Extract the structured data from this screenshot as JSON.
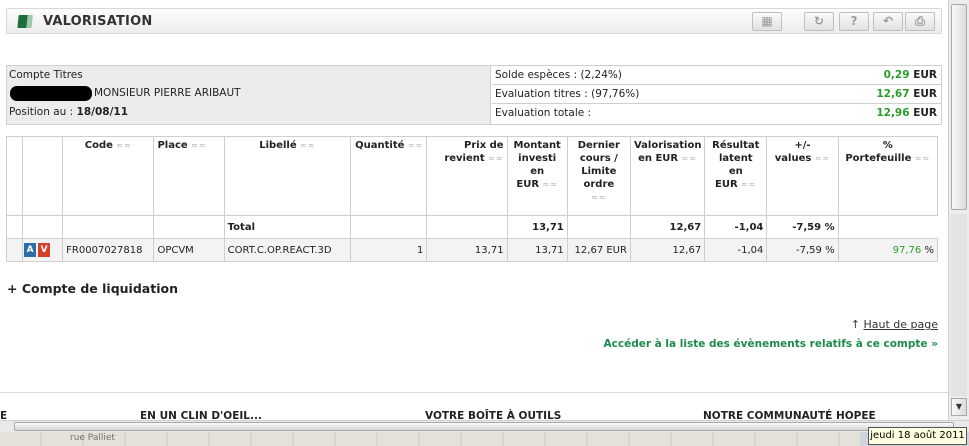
{
  "title": "VALORISATION",
  "toolbar": {
    "icons": [
      "export-icon",
      "refresh-icon",
      "help-icon",
      "back-icon",
      "print-icon"
    ],
    "glyphs": [
      "▦",
      "↻",
      "?",
      "↶",
      "⎙"
    ]
  },
  "account": {
    "label": "Compte Titres",
    "holder": "MONSIEUR PIERRE ARIBAUT",
    "position_label": "Position au :",
    "position_date": "18/08/11",
    "rows": [
      {
        "label": "Solde espèces : (2,24%)",
        "value": "0,29",
        "currency": "EUR"
      },
      {
        "label": "Evaluation titres :  (97,76%)",
        "value": "12,67",
        "currency": "EUR"
      },
      {
        "label": "Evaluation totale :",
        "value": "12,96",
        "currency": "EUR"
      }
    ]
  },
  "table": {
    "headers": {
      "code": "Code",
      "place": "Place",
      "libelle": "Libellé",
      "quantite": "Quantité",
      "prix1": "Prix de",
      "prix2": "revient",
      "mont1": "Montant",
      "mont2": "investi",
      "mont3": "en",
      "mont4": "EUR",
      "dern1": "Dernier",
      "dern2": "cours /",
      "dern3": "Limite",
      "dern4": "ordre",
      "valo1": "Valorisation",
      "valo2": "en EUR",
      "res1": "Résultat",
      "res2": "latent",
      "res3": "en",
      "res4": "EUR",
      "pm1": "+/-",
      "pm2": "values",
      "pct1": "%",
      "pct2": "Portefeuille"
    },
    "sort_arrows": "≈≈",
    "total": {
      "label": "Total",
      "montant": "13,71",
      "valorisation": "12,67",
      "resultat": "-1,04",
      "plusvalue": "-7,59 %"
    },
    "row": {
      "badge_a": "A",
      "badge_v": "V",
      "code": "FR0007027818",
      "place": "OPCVM",
      "libelle": "CORT.C.OP.REACT.3D",
      "quantite": "1",
      "prix": "13,71",
      "montant": "13,71",
      "dernier": "12,67 EUR",
      "valorisation": "12,67",
      "resultat": "-1,04",
      "plusvalue": "-7,59 %",
      "pct_value": "97,76",
      "pct_sign": "%"
    }
  },
  "liquidation": "+ Compte de liquidation",
  "haut_de_page": "Haut de page",
  "haut_arrow": "↑",
  "events_link": "Accéder à la liste des évènements relatifs à ce compte",
  "events_arrow": "»",
  "footer": {
    "left": "E",
    "col1": "EN UN CLIN D'OEIL...",
    "col2": "VOTRE BOÎTE À OUTILS",
    "col3": "NOTRE COMMUNAUTÉ HOPEE"
  },
  "map_text": "rue Palliet",
  "tooltip": "jeudi 18 août 2011",
  "colors": {
    "positive": "#2a9d2a",
    "link_green": "#1e8a4a",
    "brand": "#1f6f3a"
  }
}
